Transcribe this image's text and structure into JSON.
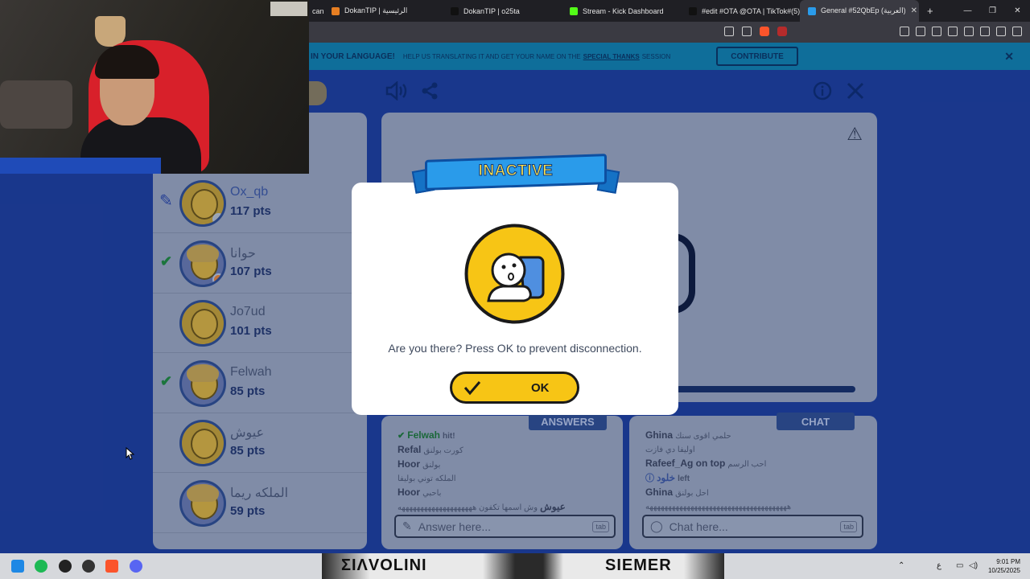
{
  "browser": {
    "tabs": [
      {
        "label": "can",
        "color": "#f39c12"
      },
      {
        "label": "DokanTIP | الرئيسية",
        "color": "#e67e22"
      },
      {
        "label": "DokanTIP | o25ta",
        "color": "#111111"
      },
      {
        "label": "Stream - Kick Dashboard",
        "color": "#53fc18"
      },
      {
        "label": "#edit #OTA @OTA | TikTok#(5)",
        "color": "#111111"
      },
      {
        "label": "General #52QbEp (العربية)",
        "color": "#2a9bea",
        "active": true
      }
    ],
    "new_tab": "+",
    "window_controls": [
      "—",
      "❐",
      "✕"
    ]
  },
  "banner": {
    "headline": "IN YOUR LANGUAGE!",
    "text": "HELP US TRANSLATING IT AND GET YOUR NAME ON THE",
    "link": "SPECIAL THANKS",
    "tail": "SESSION",
    "button": "CONTRIBUTE",
    "close": "✕"
  },
  "players": [
    {
      "name": "Ox_qb",
      "points": "117 pts",
      "status": "drawing",
      "avatar": "boy"
    },
    {
      "name": "حوانا",
      "points": "107 pts",
      "status": "guessed",
      "avatar": "girl"
    },
    {
      "name": "Jo7ud",
      "points": "101 pts",
      "status": "",
      "avatar": "boy"
    },
    {
      "name": "Felwah",
      "points": "85 pts",
      "status": "guessed",
      "avatar": "girl"
    },
    {
      "name": "عيوش",
      "points": "85 pts",
      "status": "",
      "avatar": "boy"
    },
    {
      "name": "الملكه ريما",
      "points": "59 pts",
      "status": "",
      "avatar": "girl"
    }
  ],
  "answers": {
    "tab": "ANSWERS",
    "messages": [
      {
        "user": "Felwah",
        "text": "hit!",
        "type": "hit"
      },
      {
        "user": "Refal",
        "text": "كورت بولنق"
      },
      {
        "user": "Hoor",
        "text": "بولنق"
      },
      {
        "user": "",
        "text": "الملكه توني بوليفا"
      },
      {
        "user": "Hoor",
        "text": "باحبي"
      },
      {
        "user": "عيوش",
        "text": "وش اسمها تكفون ههههههههههههههههههههه"
      }
    ],
    "placeholder": "Answer here...",
    "key_hint": "tab"
  },
  "chat": {
    "tab": "CHAT",
    "messages": [
      {
        "user": "Ghina",
        "text": "حلمي اقوى سنك"
      },
      {
        "user": "",
        "text": "اوليفا دي فازت"
      },
      {
        "user": "Rafeef_Ag on top",
        "text": "احب الرسم"
      },
      {
        "user": "خلود",
        "text": "left",
        "type": "info"
      },
      {
        "user": "Ghina",
        "text": "احل بولنق"
      },
      {
        "user": "",
        "text": "ههههههههههههههههههههههههههههههههههههههه"
      }
    ],
    "placeholder": "Chat here...",
    "key_hint": "tab"
  },
  "modal": {
    "title": "INACTIVE",
    "message": "Are you there? Press OK to prevent disconnection.",
    "ok_label": "OK"
  },
  "taskbar": {
    "time": "9:01 PM",
    "date": "10/25/2025",
    "lang": "ع",
    "shirt_left": "ΣΙΛVOLINI",
    "shirt_right": "SIEMER"
  },
  "colors": {
    "page_bg": "#1d3f9e",
    "panel": "#9aa7bf",
    "accent_yellow": "#f7c515",
    "ribbon_blue": "#2a9bea"
  }
}
